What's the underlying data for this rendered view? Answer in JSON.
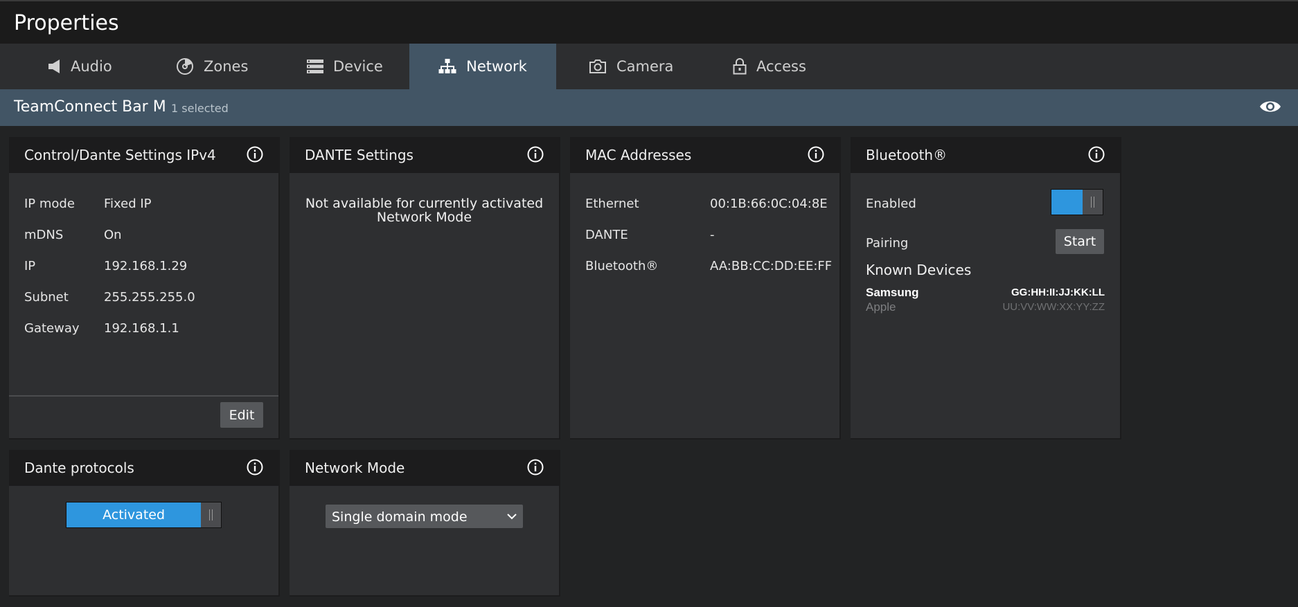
{
  "app": {
    "title": "Properties"
  },
  "tabs": [
    {
      "label": "Audio",
      "icon": "speaker-icon"
    },
    {
      "label": "Zones",
      "icon": "zones-icon"
    },
    {
      "label": "Device",
      "icon": "device-icon"
    },
    {
      "label": "Network",
      "icon": "network-icon",
      "active": true
    },
    {
      "label": "Camera",
      "icon": "camera-icon"
    },
    {
      "label": "Access",
      "icon": "lock-icon"
    }
  ],
  "subheader": {
    "device_name": "TeamConnect Bar M",
    "selection": "1 selected",
    "icon": "eye-icon"
  },
  "control_panel": {
    "title": "Control/Dante Settings IPv4",
    "rows": [
      {
        "key": "IP mode",
        "value": "Fixed IP"
      },
      {
        "key": "mDNS",
        "value": "On"
      },
      {
        "key": "IP",
        "value": "192.168.1.29"
      },
      {
        "key": "Subnet",
        "value": "255.255.255.0"
      },
      {
        "key": "Gateway",
        "value": "192.168.1.1"
      }
    ],
    "edit_label": "Edit"
  },
  "dante_panel": {
    "title": "DANTE Settings",
    "message_line1": "Not available for currently activated",
    "message_line2": "Network Mode"
  },
  "mac_panel": {
    "title": "MAC Addresses",
    "rows": [
      {
        "key": "Ethernet",
        "value": "00:1B:66:0C:04:8E"
      },
      {
        "key": "DANTE",
        "value": "-"
      },
      {
        "key": "Bluetooth®",
        "value": "AA:BB:CC:DD:EE:FF"
      }
    ]
  },
  "bluetooth_panel": {
    "title": "Bluetooth®",
    "enabled_label": "Enabled",
    "enabled": true,
    "pairing_label": "Pairing",
    "start_label": "Start",
    "known_devices_title": "Known Devices",
    "devices": [
      {
        "name": "Samsung",
        "mac": "GG:HH:II:JJ:KK:LL",
        "connected": true
      },
      {
        "name": "Apple",
        "mac": "UU:VV:WW:XX:YY:ZZ",
        "connected": false
      }
    ]
  },
  "protocols_panel": {
    "title": "Dante protocols",
    "toggle_label": "Activated",
    "active": true
  },
  "network_mode_panel": {
    "title": "Network Mode",
    "selected": "Single domain mode"
  },
  "colors": {
    "accent": "#2e96de",
    "active_tab": "#425565",
    "panel": "#2e2f31",
    "panel_header": "#1c1c1d"
  }
}
